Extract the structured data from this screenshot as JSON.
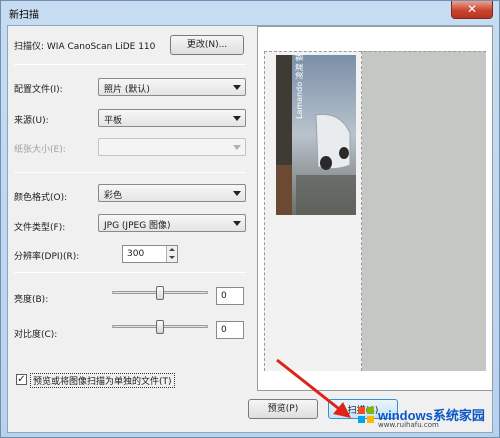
{
  "window": {
    "title": "新扫描",
    "close_symbol": "✕"
  },
  "scanner": {
    "label": "扫描仪: WIA CanoScan LiDE 110",
    "change_button": "更改(N)..."
  },
  "fields": {
    "profile": {
      "label": "配置文件(I):",
      "value": "照片 (默认)"
    },
    "source": {
      "label": "来源(U):",
      "value": "平板"
    },
    "paper_size": {
      "label": "纸张大小(E):",
      "value": ""
    },
    "color_format": {
      "label": "颜色格式(O):",
      "value": "彩色"
    },
    "file_type": {
      "label": "文件类型(F):",
      "value": "JPG (JPEG 图像)"
    },
    "resolution": {
      "label": "分辨率(DPI)(R):",
      "value": "300"
    },
    "brightness": {
      "label": "亮度(B):",
      "value": "0",
      "level": 0.5
    },
    "contrast": {
      "label": "对比度(C):",
      "value": "0",
      "level": 0.5
    }
  },
  "separate_files": {
    "label": "预览或将图像扫描为单独的文件(T)",
    "checked": true
  },
  "buttons": {
    "preview": "预览(P)",
    "scan": "扫描(S)"
  },
  "preview_image": {
    "text": "Lamando 凌渡 魅·力"
  },
  "watermark": {
    "brand": "windows系统家园",
    "url": "www.ruihafu.com"
  }
}
